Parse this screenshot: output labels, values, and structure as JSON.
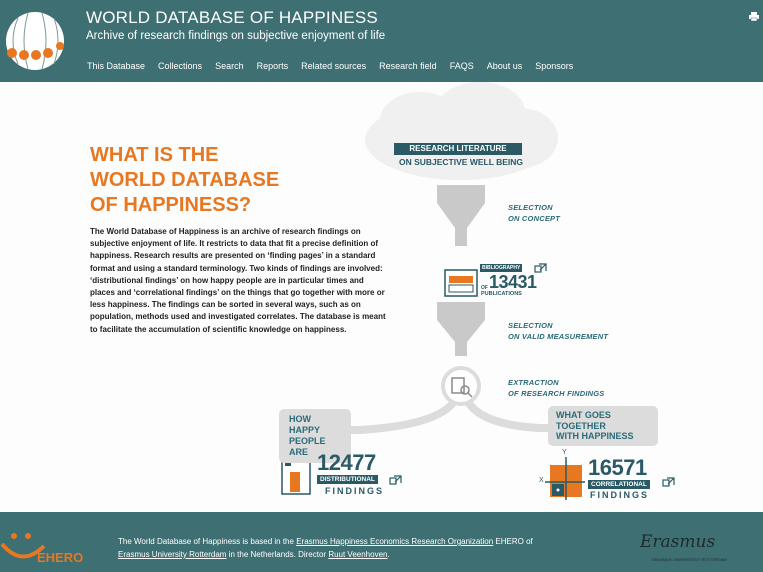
{
  "header": {
    "title": "WORLD DATABASE OF HAPPINESS",
    "subtitle": "Archive of research findings on subjective enjoyment of life",
    "nav": [
      "This Database",
      "Collections",
      "Search",
      "Reports",
      "Related sources",
      "Research field",
      "FAQS",
      "About us",
      "Sponsors"
    ]
  },
  "main": {
    "heading": [
      "WHAT IS THE",
      "WORLD DATABASE",
      "OF HAPPINESS?"
    ],
    "intro": "The World Database of Happiness is an archive of research findings on subjective enjoyment of life. It restricts to data that fit a precise definition of happiness. Research results are presented on ‘finding pages’ in a standard format and using a standard terminology. Two kinds of findings are involved: ‘distributional findings’ on how happy people are in particular times and places and ‘correlational findings’ on the things that go together with more or less happiness. The findings can be sorted in several ways, such as on population, methods used and investigated correlates. The database is meant to facilitate the accumulation of scientific knowledge on happiness."
  },
  "diagram": {
    "research_literature_line1": "RESEARCH LITERATURE",
    "research_literature_line2": "ON SUBJECTIVE WELL BEING",
    "step1": [
      "SELECTION",
      "ON CONCEPT"
    ],
    "bibliography_label": "BIBLIOGRAPHY",
    "bibliography_count": "13431",
    "bibliography_of": "OF",
    "bibliography_unit": "PUBLICATIONS",
    "step2": [
      "SELECTION",
      "ON VALID MEASUREMENT"
    ],
    "step3": [
      "EXTRACTION",
      "OF RESEARCH FINDINGS"
    ],
    "left_box": [
      "HOW HAPPY",
      "PEOPLE ARE"
    ],
    "right_box": [
      "WHAT GOES",
      "TOGETHER",
      "WITH HAPPINESS"
    ],
    "distributional_count": "12477",
    "distributional_label": "DISTRIBUTIONAL",
    "distributional_unit": "FINDINGS",
    "correlational_count": "16571",
    "correlational_label": "CORRELATIONAL",
    "correlational_unit": "FINDINGS",
    "axis_y": "Y",
    "axis_x": "X"
  },
  "footer": {
    "ehero_logo": "EHERO",
    "text_prefix": "The World Database of Happiness is based in the ",
    "link1": "Erasmus Happiness Economics Research Organization",
    "text_mid1": " EHERO of",
    "link2": "Erasmus University Rotterdam",
    "text_mid2": " in the Netherlands. Director ",
    "link3": "Ruut Veenhoven",
    "text_suffix": ".",
    "erasmus_logo": "Erasmus",
    "erasmus_caption": "ERASMUS UNIVERSITEIT ROTTERDAM"
  },
  "colors": {
    "header_bg": "#3e6f73",
    "accent_orange": "#e87722",
    "dark_teal": "#2a5a66"
  }
}
